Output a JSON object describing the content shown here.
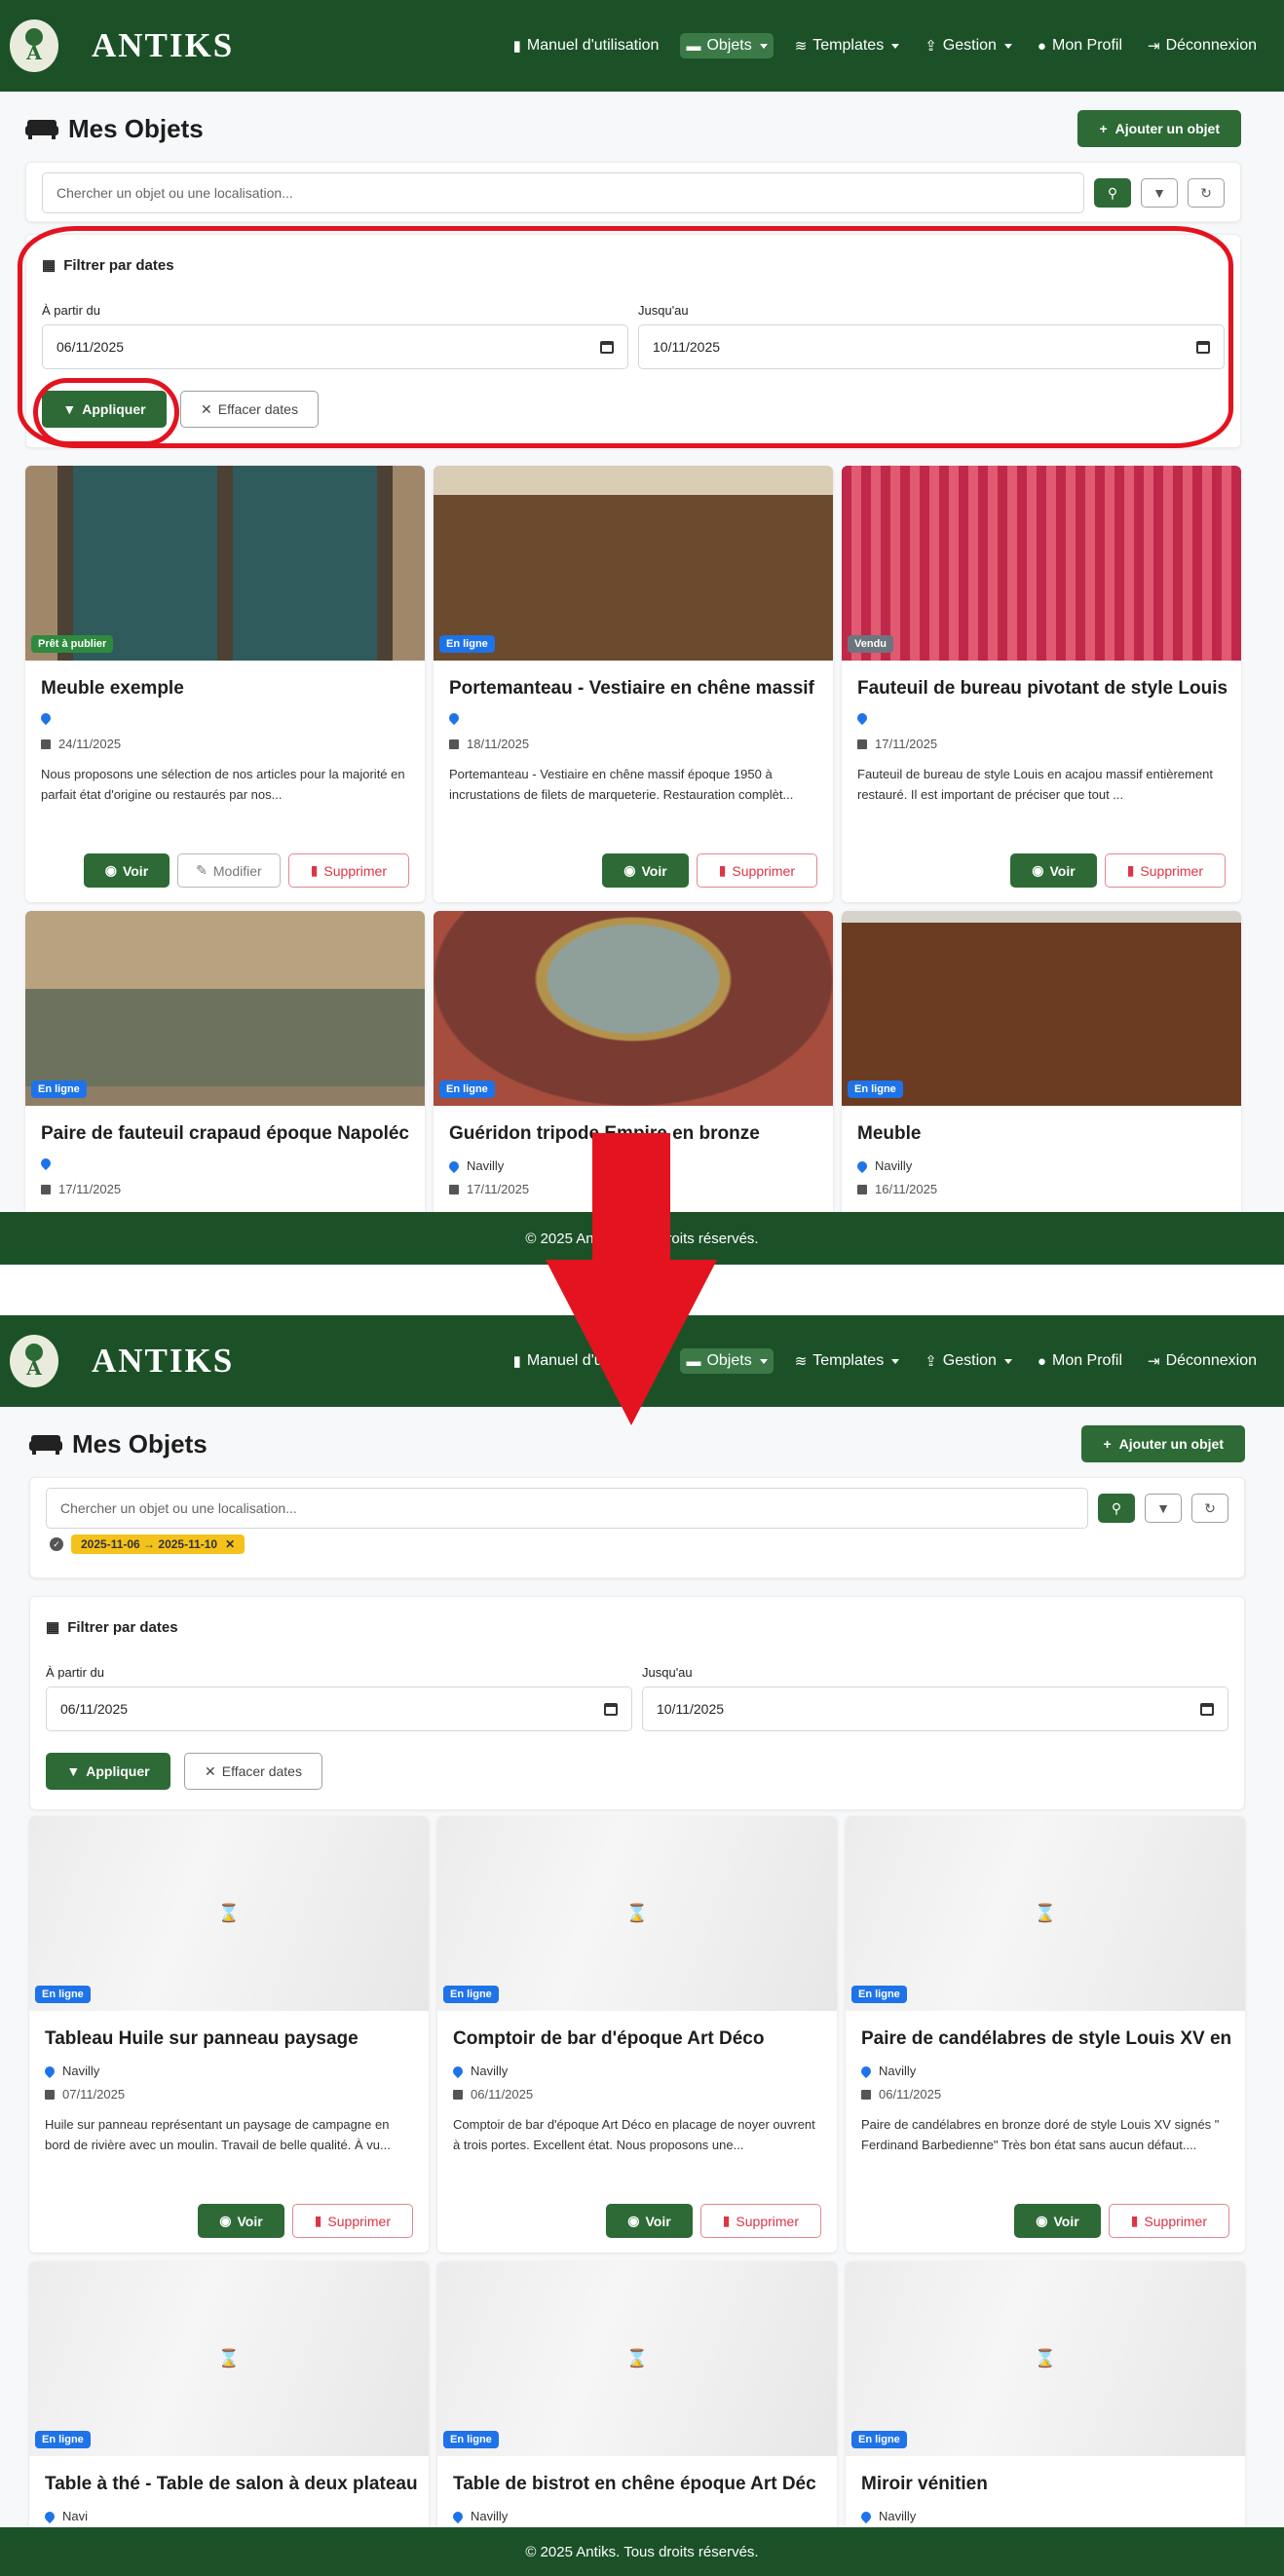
{
  "brand": "ANTIKS",
  "nav": {
    "items": [
      {
        "label": "Manuel d'utilisation",
        "icon": "book-icon"
      },
      {
        "label": "Objets",
        "icon": "sofa-icon",
        "dropdown": true,
        "active": true
      },
      {
        "label": "Templates",
        "icon": "layers-icon",
        "dropdown": true
      },
      {
        "label": "Gestion",
        "icon": "upload-icon",
        "dropdown": true
      },
      {
        "label": "Mon Profil",
        "icon": "user-icon"
      },
      {
        "label": "Déconnexion",
        "icon": "logout-icon"
      }
    ]
  },
  "page": {
    "title": "Mes Objets",
    "add_label": "Ajouter un objet"
  },
  "search": {
    "placeholder": "Chercher un objet ou une localisation..."
  },
  "filter": {
    "title": "Filtrer par dates",
    "from_label": "À partir du",
    "to_label": "Jusqu'au",
    "from_value": "06/11/2025",
    "to_value": "10/11/2025",
    "apply_label": "Appliquer",
    "clear_label": "Effacer dates"
  },
  "active_chip": "2025-11-06 → 2025-11-10",
  "footer": "© 2025 Antiks. Tous droits réservés.",
  "labels": {
    "voir": "Voir",
    "modifier": "Modifier",
    "supprimer": "Supprimer"
  },
  "before_items": [
    {
      "title": "Meuble exemple",
      "status": "Prêt à publier",
      "location": "",
      "date": "24/11/2025",
      "desc": "Nous proposons une sélection de nos articles pour la majorité en parfait état d'origine ou restaurés par nos...",
      "editable": true
    },
    {
      "title": "Portemanteau - Vestiaire en chêne massif",
      "status": "En ligne",
      "location": "",
      "date": "18/11/2025",
      "desc": "Portemanteau - Vestiaire en chêne massif époque 1950 à incrustations de filets de marqueterie. Restauration complèt...",
      "editable": false
    },
    {
      "title": "Fauteuil de bureau pivotant de style Louis",
      "status": "Vendu",
      "location": "",
      "date": "17/11/2025",
      "desc": "Fauteuil de bureau de style Louis en acajou massif entièrement restauré. Il est important de préciser que tout ...",
      "editable": false
    },
    {
      "title": "Paire de fauteuil crapaud époque Napoléc",
      "status": "En ligne",
      "location": "",
      "date": "17/11/2025",
      "desc": "",
      "editable": false
    },
    {
      "title": "Guéridon tripode Empire en bronze",
      "status": "En ligne",
      "location": "Navilly",
      "date": "17/11/2025",
      "desc": "",
      "editable": false
    },
    {
      "title": "Meuble",
      "status": "En ligne",
      "location": "Navilly",
      "date": "16/11/2025",
      "desc": "",
      "editable": false
    }
  ],
  "after_items": [
    {
      "title": "Tableau Huile sur panneau paysage",
      "status": "En ligne",
      "location": "Navilly",
      "date": "07/11/2025",
      "desc": "Huile sur panneau représentant un paysage de campagne en bord de rivière avec un moulin. Travail de belle qualité. À vu..."
    },
    {
      "title": "Comptoir de bar d'époque Art Déco",
      "status": "En ligne",
      "location": "Navilly",
      "date": "06/11/2025",
      "desc": "Comptoir de bar d'époque Art Déco en placage de noyer ouvrent à trois portes. Excellent état. Nous proposons une..."
    },
    {
      "title": "Paire de candélabres de style Louis XV en",
      "status": "En ligne",
      "location": "Navilly",
      "date": "06/11/2025",
      "desc": "Paire de candélabres en bronze doré de style Louis XV signés \" Ferdinand Barbedienne\" Très bon état sans aucun défaut...."
    },
    {
      "title": "Table à thé - Table de salon à deux plateau",
      "status": "En ligne",
      "location": "Navi",
      "date": "",
      "desc": ""
    },
    {
      "title": "Table de bistrot en chêne époque Art Déc",
      "status": "En ligne",
      "location": "Navilly",
      "date": "",
      "desc": ""
    },
    {
      "title": "Miroir vénitien",
      "status": "En ligne",
      "location": "Navilly",
      "date": "",
      "desc": ""
    }
  ],
  "colors": {
    "brand_green": "#1c5128",
    "button_green": "#2d6a36",
    "annotation_red": "#e3131f",
    "online_badge": "#1e73e8"
  }
}
